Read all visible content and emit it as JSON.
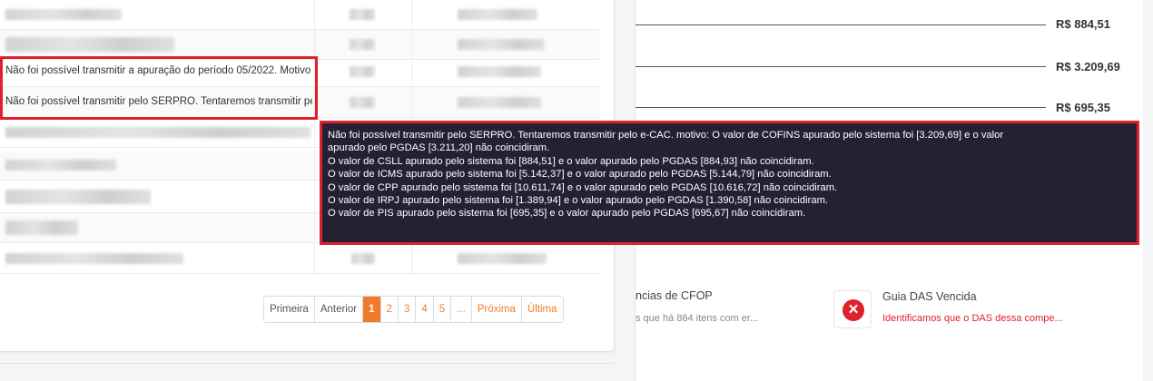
{
  "table": {
    "error_message_1": "Não foi possível transmitir a apuração do período 05/2022. Motivo",
    "error_message_2": "Não foi possível transmitir pelo SERPRO. Tentaremos transmitir pelo e-CAC"
  },
  "pagination": {
    "first": "Primeira",
    "previous": "Anterior",
    "pages": [
      "1",
      "2",
      "3",
      "4",
      "5"
    ],
    "active_page": "1",
    "ellipsis": "...",
    "next": "Próxima",
    "last": "Última"
  },
  "right_panel": {
    "amounts": [
      "R$ 884,51",
      "R$ 3.209,69",
      "R$ 695,35"
    ],
    "cfop_card": {
      "title": "ncias de CFOP",
      "subtitle": "s que há 864 itens com er..."
    },
    "das_card": {
      "title": "Guia DAS Vencida",
      "subtitle": "Identificamos que o DAS dessa compe...",
      "icon": "close-icon"
    }
  },
  "tooltip": {
    "lines": [
      "Não foi possível transmitir pelo SERPRO. Tentaremos transmitir pelo e-CAC. motivo: O valor de COFINS apurado pelo sistema foi [3.209,69] e o valor",
      "apurado pelo PGDAS [3.211,20] não coincidiram.",
      "O valor de CSLL apurado pelo sistema foi [884,51] e o valor apurado pelo PGDAS [884,93] não coincidiram.",
      "O valor de ICMS apurado pelo sistema foi [5.142,37] e o valor apurado pelo PGDAS [5.144,79] não coincidiram.",
      "O valor de CPP apurado pelo sistema foi [10.611,74] e o valor apurado pelo PGDAS [10.616,72] não coincidiram.",
      "O valor de IRPJ apurado pelo sistema foi [1.389,94] e o valor apurado pelo PGDAS [1.390,58] não coincidiram.",
      "O valor de PIS apurado pelo sistema foi [695,35] e o valor apurado pelo PGDAS [695,67] não coincidiram."
    ]
  },
  "colors": {
    "accent": "#f07b2b",
    "error": "#e0212b",
    "tooltip_bg": "#242135"
  }
}
